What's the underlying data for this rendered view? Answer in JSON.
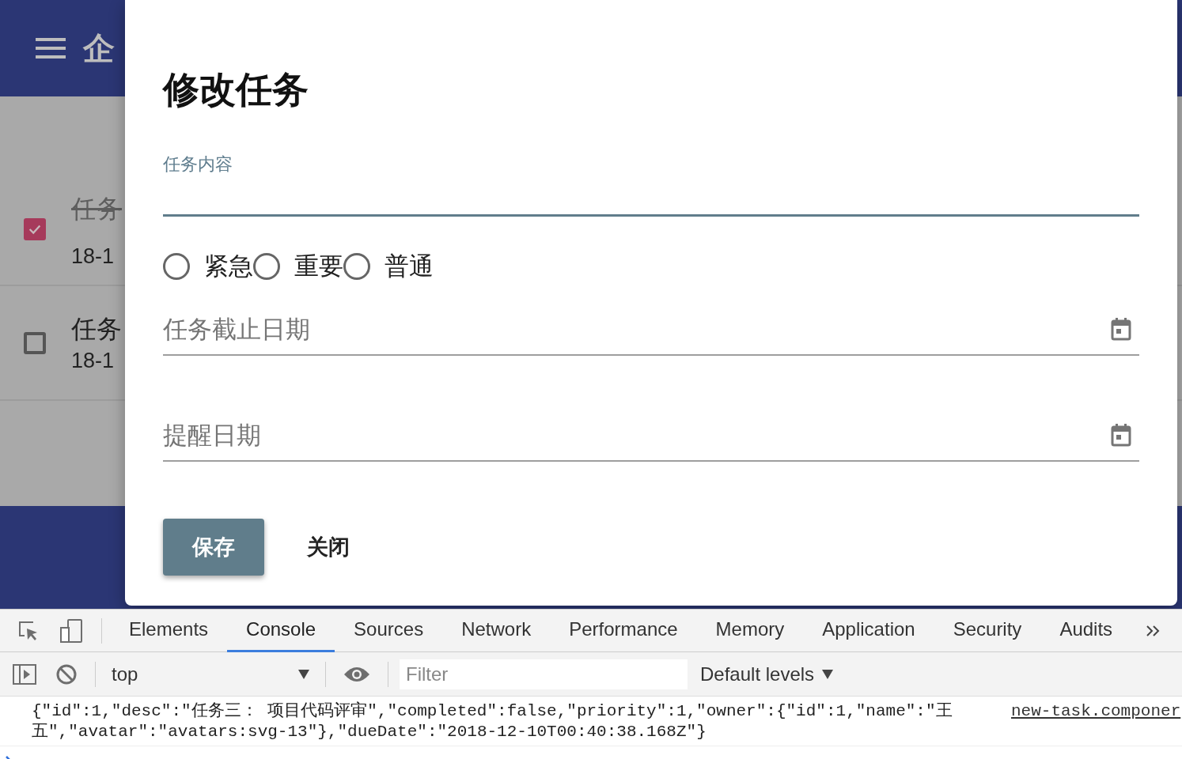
{
  "app": {
    "title": "企",
    "tasks": [
      {
        "desc": "任务",
        "date": "18-1",
        "completed": true
      },
      {
        "desc": "任务",
        "date": "18-1",
        "completed": false
      }
    ]
  },
  "dialog": {
    "title": "修改任务",
    "content_field": {
      "label": "任务内容"
    },
    "priorities": [
      {
        "label": "紧急",
        "selected": false
      },
      {
        "label": "重要",
        "selected": false
      },
      {
        "label": "普通",
        "selected": false
      }
    ],
    "due_date": {
      "placeholder": "任务截止日期"
    },
    "reminder": {
      "placeholder": "提醒日期"
    },
    "buttons": [
      {
        "label": "保存",
        "kind": "primary"
      },
      {
        "label": "关闭",
        "kind": "flat"
      }
    ]
  },
  "devtools": {
    "tabs": [
      {
        "label": "Elements",
        "selected": false
      },
      {
        "label": "Console",
        "selected": true
      },
      {
        "label": "Sources",
        "selected": false
      },
      {
        "label": "Network",
        "selected": false
      },
      {
        "label": "Performance",
        "selected": false
      },
      {
        "label": "Memory",
        "selected": false
      },
      {
        "label": "Application",
        "selected": false
      },
      {
        "label": "Security",
        "selected": false
      },
      {
        "label": "Audits",
        "selected": false
      }
    ],
    "context": "top",
    "filter": {
      "placeholder": "Filter"
    },
    "levels": "Default levels",
    "messages": [
      {
        "text": "{\"id\":1,\"desc\":\"任务三： 项目代码评审\",\"completed\":false,\"priority\":1,\"owner\":{\"id\":1,\"name\":\"王五\",\"avatar\":\"avatars:svg-13\"},\"dueDate\":\"2018-12-10T00:40:38.168Z\"}",
        "source": "new-task.componer"
      }
    ]
  }
}
